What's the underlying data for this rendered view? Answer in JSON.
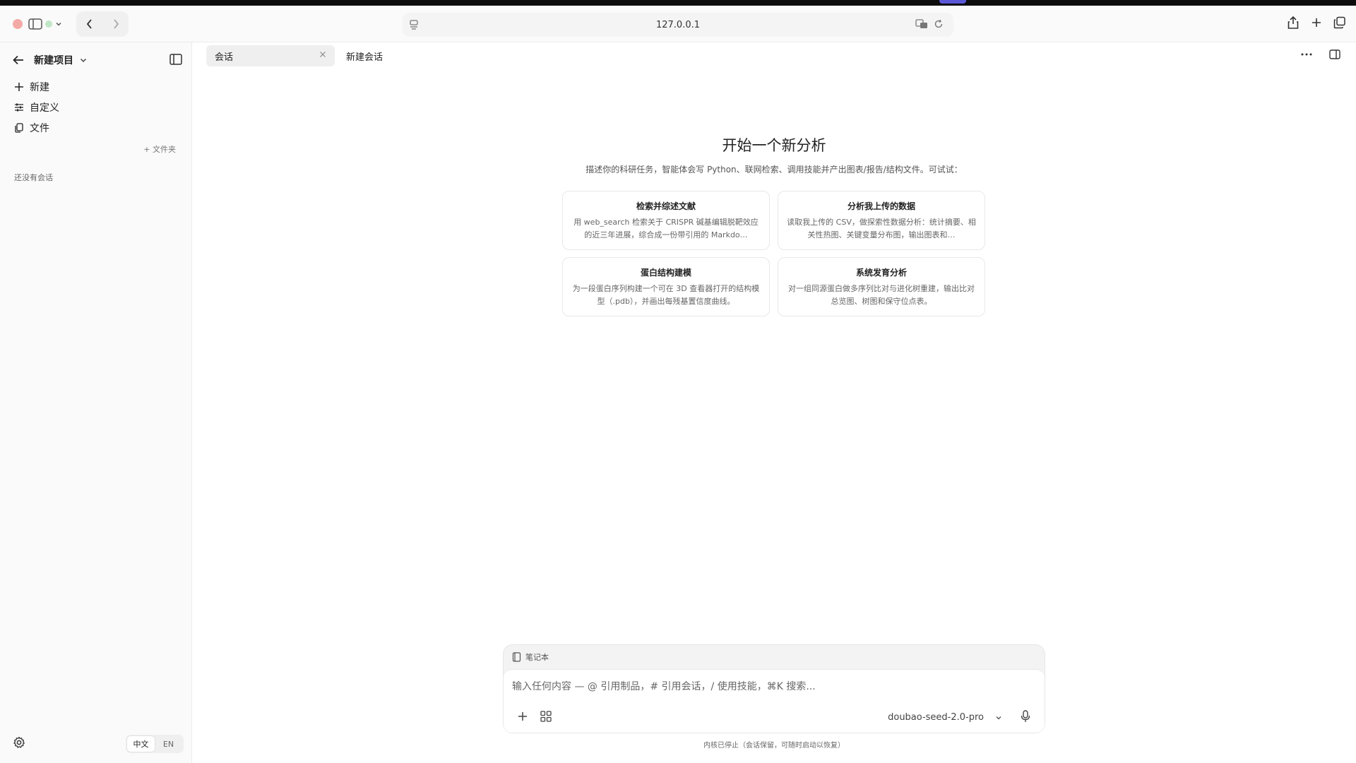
{
  "browser": {
    "url": "127.0.0.1"
  },
  "sidebar": {
    "project_title": "新建项目",
    "menu": [
      {
        "label": "新建",
        "icon": "plus-icon"
      },
      {
        "label": "自定义",
        "icon": "sliders-icon"
      },
      {
        "label": "文件",
        "icon": "files-icon"
      }
    ],
    "folder_button": "+ 文件夹",
    "empty_state": "还没有会话",
    "language": {
      "zh": "中文",
      "en": "EN",
      "selected": "中文"
    }
  },
  "tabs": {
    "active_label": "会话",
    "new_label": "新建会话"
  },
  "welcome": {
    "title": "开始一个新分析",
    "subtitle": "描述你的科研任务，智能体会写 Python、联网检索、调用技能并产出图表/报告/结构文件。可试试：",
    "cards": [
      {
        "title": "检索并综述文献",
        "desc": "用 web_search 检索关于 CRISPR 碱基编辑脱靶效应的近三年进展，综合成一份带引用的 Markdo…"
      },
      {
        "title": "分析我上传的数据",
        "desc": "读取我上传的 CSV，做探索性数据分析：统计摘要、相关性热图、关键变量分布图，输出图表和…"
      },
      {
        "title": "蛋白结构建模",
        "desc": "为一段蛋白序列构建一个可在 3D 查看器打开的结构模型（.pdb），并画出每残基置信度曲线。"
      },
      {
        "title": "系统发育分析",
        "desc": "对一组同源蛋白做多序列比对与进化树重建，输出比对总览图、树图和保守位点表。"
      }
    ]
  },
  "composer": {
    "notebook_label": "笔记本",
    "placeholder": "输入任何内容 — @ 引用制品，# 引用会话，/ 使用技能，⌘K 搜索...",
    "model": "doubao-seed-2.0-pro",
    "status": "内核已停止（会话保留，可随时启动以恢复）"
  }
}
